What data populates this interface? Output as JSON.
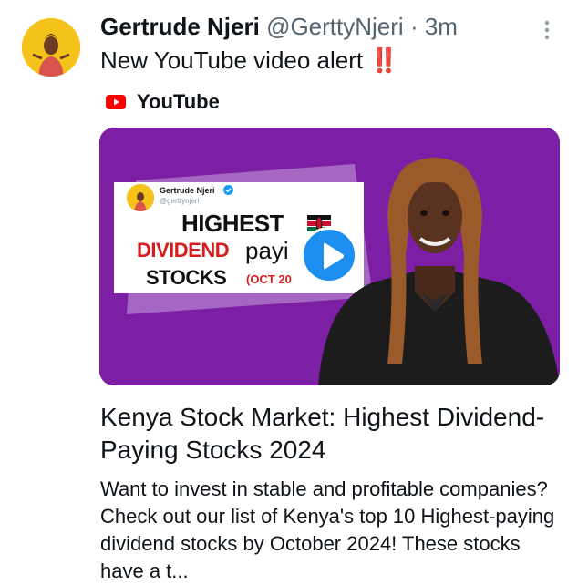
{
  "tweet": {
    "author": "Gertrude Njeri",
    "handle": "@GerttyNjeri",
    "separator": "·",
    "time": "3m",
    "text": "New YouTube video alert",
    "alert_emoji": "‼️"
  },
  "source": {
    "label": "YouTube",
    "icon": "youtube-logo-icon"
  },
  "thumbnail": {
    "name": "Gertrude Njeri",
    "handle": "@gerttynjeri",
    "line1": "HIGHEST",
    "line2a": "DIVIDEND",
    "line2b": "payi",
    "line3a": "STOCKS",
    "line3b": "(OCT 20",
    "flag_icon": "kenya-flag-icon",
    "play_icon": "play-icon"
  },
  "link": {
    "title": "Kenya Stock Market: Highest Dividend-Paying Stocks 2024",
    "description": "Want to invest in stable and profitable companies? Check out our list of Kenya's top 10 Highest-paying dividend stocks by October 2024! These stocks have a t..."
  },
  "colors": {
    "card_bg": "#7c1fa5",
    "youtube_red": "#ff0000",
    "alert_red": "#e0241d",
    "play_blue": "#1d8ff0",
    "muted_text": "#536471"
  }
}
